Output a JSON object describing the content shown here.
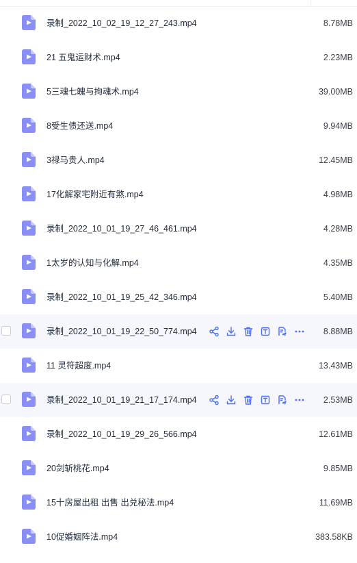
{
  "files": [
    {
      "name": "录制_2022_10_02_19_12_27_243.mp4",
      "size": "8.78MB",
      "icon": "video-file-icon"
    },
    {
      "name": "21 五鬼运财术.mp4",
      "size": "2.23MB",
      "icon": "video-file-icon"
    },
    {
      "name": "5三魂七魄与拘魂术.mp4",
      "size": "39.00MB",
      "icon": "video-file-icon"
    },
    {
      "name": "8受生债还送.mp4",
      "size": "9.94MB",
      "icon": "video-file-icon"
    },
    {
      "name": "3禄马贵人.mp4",
      "size": "12.45MB",
      "icon": "video-file-icon"
    },
    {
      "name": "17化解家宅附近有煞.mp4",
      "size": "4.98MB",
      "icon": "video-file-icon"
    },
    {
      "name": "录制_2022_10_01_19_27_46_461.mp4",
      "size": "4.28MB",
      "icon": "video-file-icon"
    },
    {
      "name": "1太岁的认知与化解.mp4",
      "size": "4.35MB",
      "icon": "video-file-icon"
    },
    {
      "name": "录制_2022_10_01_19_25_42_346.mp4",
      "size": "5.40MB",
      "icon": "video-file-icon"
    },
    {
      "name": "录制_2022_10_01_19_22_50_774.mp4",
      "size": "8.88MB",
      "icon": "video-file-icon",
      "hover": true
    },
    {
      "name": "11 灵符超度.mp4",
      "size": "13.43MB",
      "icon": "video-file-icon"
    },
    {
      "name": "录制_2022_10_01_19_21_17_174.mp4",
      "size": "2.53MB",
      "icon": "video-file-icon",
      "hover": true
    },
    {
      "name": "录制_2022_10_01_19_29_26_566.mp4",
      "size": "12.61MB",
      "icon": "video-file-icon"
    },
    {
      "name": "20剑斩桃花.mp4",
      "size": "9.85MB",
      "icon": "video-file-icon"
    },
    {
      "name": "15十房屋出租 出售 出兑秘法.mp4",
      "size": "11.69MB",
      "icon": "video-file-icon"
    },
    {
      "name": "10促婚姻阵法.mp4",
      "size": "383.58KB",
      "icon": "video-file-icon"
    }
  ],
  "row_actions": [
    "share-icon",
    "download-icon",
    "delete-icon",
    "rename-icon",
    "copy-move-icon",
    "more-icon"
  ],
  "colors": {
    "icon_bg": "#8a8ff7",
    "icon_fold": "#c7caff",
    "action": "#4a6cf7",
    "hover_bg": "#f6f7fc"
  }
}
